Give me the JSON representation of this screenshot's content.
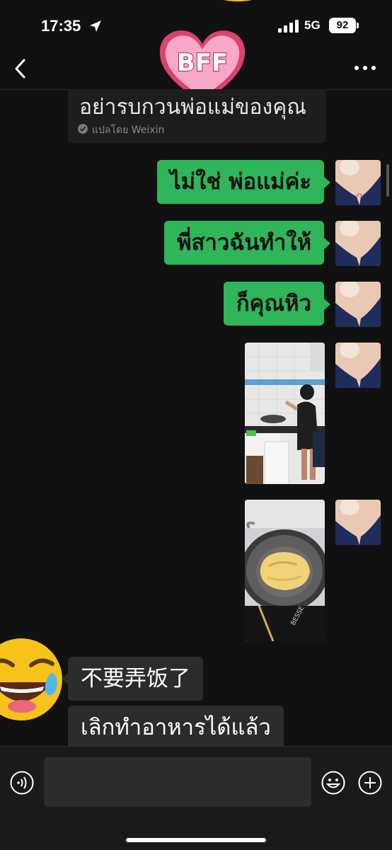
{
  "status_bar": {
    "time": "17:35",
    "network": "5G",
    "battery": "92"
  },
  "header": {
    "sticker_text": "BFF"
  },
  "translated_message": {
    "text": "อย่ารบกวนพ่อแม่ของคุณ",
    "note": "แปลโดย Weixin"
  },
  "messages": [
    {
      "direction": "out",
      "type": "text",
      "text": "ไม่ใช่ พ่อแม่ค่ะ"
    },
    {
      "direction": "out",
      "type": "text",
      "text": "พี่สาวฉันทำให้"
    },
    {
      "direction": "out",
      "type": "text",
      "text": "ก็คุณหิว"
    },
    {
      "direction": "out",
      "type": "image",
      "description": "girl-cooking-photo"
    },
    {
      "direction": "out",
      "type": "image",
      "description": "omelette-in-wok-photo",
      "visible_text": "BESSE"
    },
    {
      "direction": "in",
      "type": "text",
      "text": "不要弄饭了"
    },
    {
      "direction": "in",
      "type": "text",
      "text": "เลิกทำอาหารได้แล้ว"
    }
  ],
  "icons": {
    "back": "chevron-left-icon",
    "more": "ellipsis-icon",
    "voice": "voice-input-icon",
    "emoji": "emoji-icon",
    "plus": "plus-icon"
  },
  "colors": {
    "outgoing_bubble": "#2fb55a",
    "incoming_bubble": "#2c2c2c",
    "background": "#111111"
  }
}
